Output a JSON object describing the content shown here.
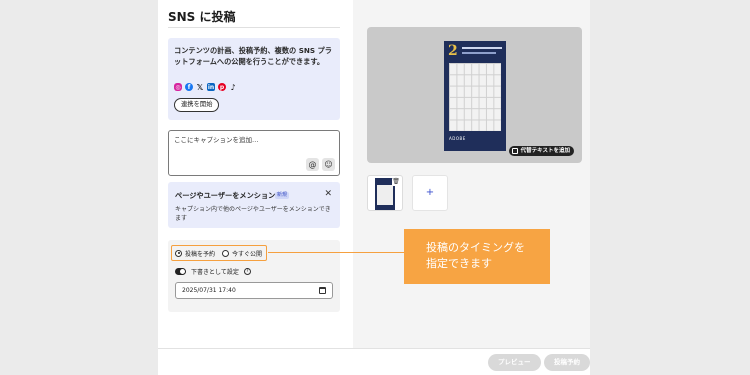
{
  "header": {
    "title": "SNS に投稿"
  },
  "intro": {
    "text": "コンテンツの計画、投稿予約、複数の SNS プラットフォームへの公開を行うことができます。",
    "platform_icons": [
      "instagram-icon",
      "facebook-icon",
      "x-icon",
      "linkedin-icon",
      "pinterest-icon",
      "tiktok-icon"
    ],
    "connect_label": "連携を開始"
  },
  "caption": {
    "placeholder": "ここにキャプションを追加…"
  },
  "mention": {
    "title": "ページやユーザーをメンション",
    "badge": "新規",
    "close_symbol": "✕",
    "description": "キャプション内で他のページやユーザーをメンションできます"
  },
  "schedule": {
    "options": [
      {
        "label": "投稿を予約",
        "selected": true
      },
      {
        "label": "今すぐ公開",
        "selected": false
      }
    ],
    "draft_label": "下書きとして設定",
    "draft_enabled": true,
    "datetime_value": "2025/07/31 17:40"
  },
  "callout": {
    "text": "投稿のタイミングを指定できます",
    "color": "#f7a443"
  },
  "preview": {
    "alt_text_label": "代替テキストを追加",
    "poster_number": "2",
    "poster_footer": "ADOBE"
  },
  "media": {
    "add_label": "+"
  },
  "footer": {
    "preview_label": "プレビュー",
    "schedule_label": "投稿予約"
  }
}
